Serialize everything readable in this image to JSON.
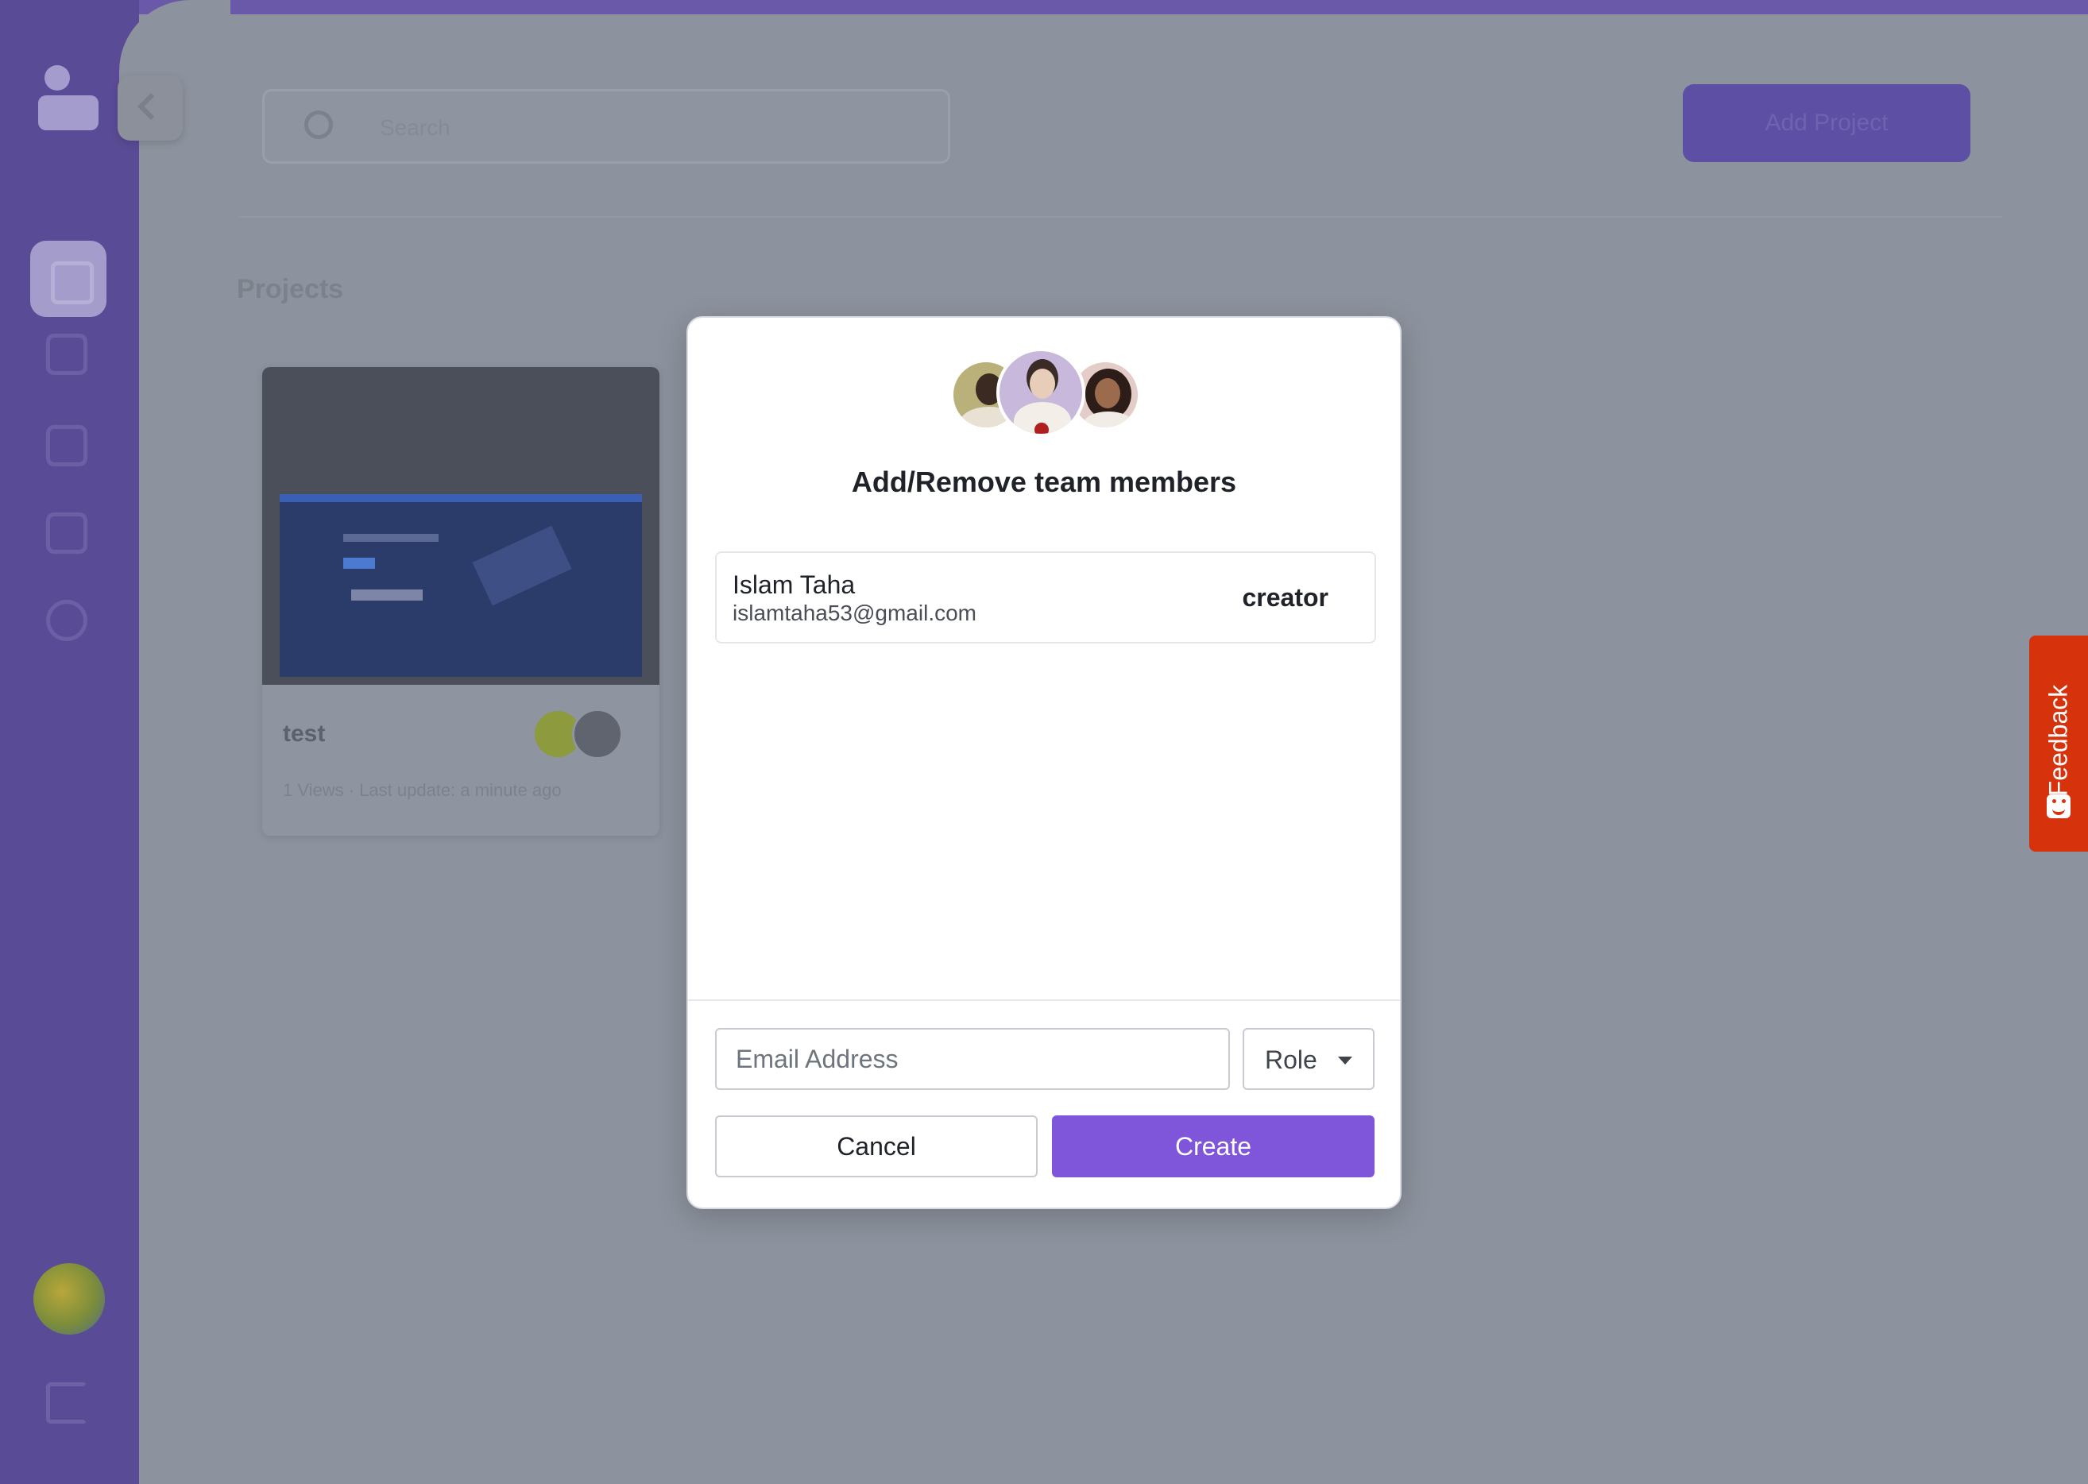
{
  "background": {
    "search": {
      "placeholder": "Search"
    },
    "add_project_label": "Add Project",
    "section_title": "Projects",
    "project_card": {
      "name": "test",
      "meta": "1 Views · Last update: a minute ago"
    }
  },
  "sidebar": {
    "items": [
      {
        "icon": "dashboard-icon",
        "active": true
      },
      {
        "icon": "user-icon"
      },
      {
        "icon": "calendar-icon"
      },
      {
        "icon": "board-icon"
      },
      {
        "icon": "settings-icon"
      }
    ],
    "logout_icon": "logout-icon"
  },
  "feedback": {
    "label": "Feedback",
    "icon": "smile-icon"
  },
  "modal": {
    "title": "Add/Remove team members",
    "members": [
      {
        "name": "Islam Taha",
        "email": "islamtaha53@gmail.com",
        "role": "creator"
      }
    ],
    "email_placeholder": "Email Address",
    "role_label": "Role",
    "cancel_label": "Cancel",
    "create_label": "Create"
  },
  "colors": {
    "accent": "#7f56d9",
    "sidebar": "#5a4b96",
    "feedback": "#d6330c",
    "overlay": "#8d939e"
  }
}
